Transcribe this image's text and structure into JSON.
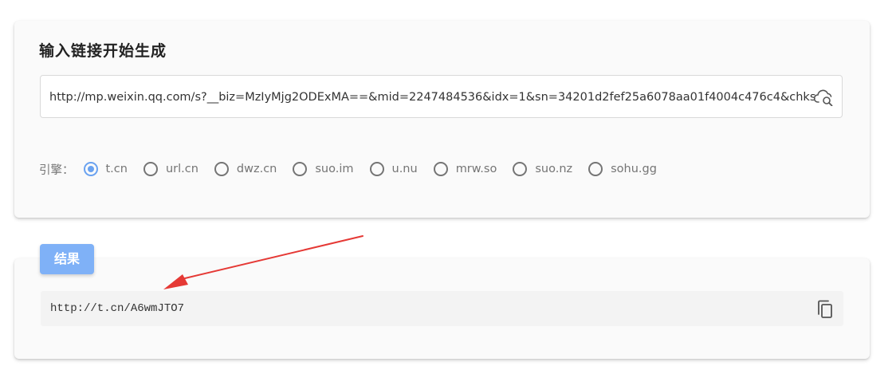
{
  "input_section": {
    "title": "输入链接开始生成",
    "url_value": "http://mp.weixin.qq.com/s?__biz=MzIyMjg2ODExMA==&mid=2247484536&idx=1&sn=34201d2fef25a6078aa01f4004c476c4&chksm=e",
    "action_icon": "cloud-search-icon"
  },
  "engine": {
    "label": "引擎：",
    "selected": "t.cn",
    "options": [
      "t.cn",
      "url.cn",
      "dwz.cn",
      "suo.im",
      "u.nu",
      "mrw.so",
      "suo.nz",
      "sohu.gg"
    ]
  },
  "result": {
    "badge": "结果",
    "short_url": "http://t.cn/A6wmJTO7",
    "copy_icon": "copy-icon"
  },
  "colors": {
    "accent": "#6aa2f0",
    "badge": "#7fb1f7",
    "annotation_arrow": "#e53935"
  }
}
